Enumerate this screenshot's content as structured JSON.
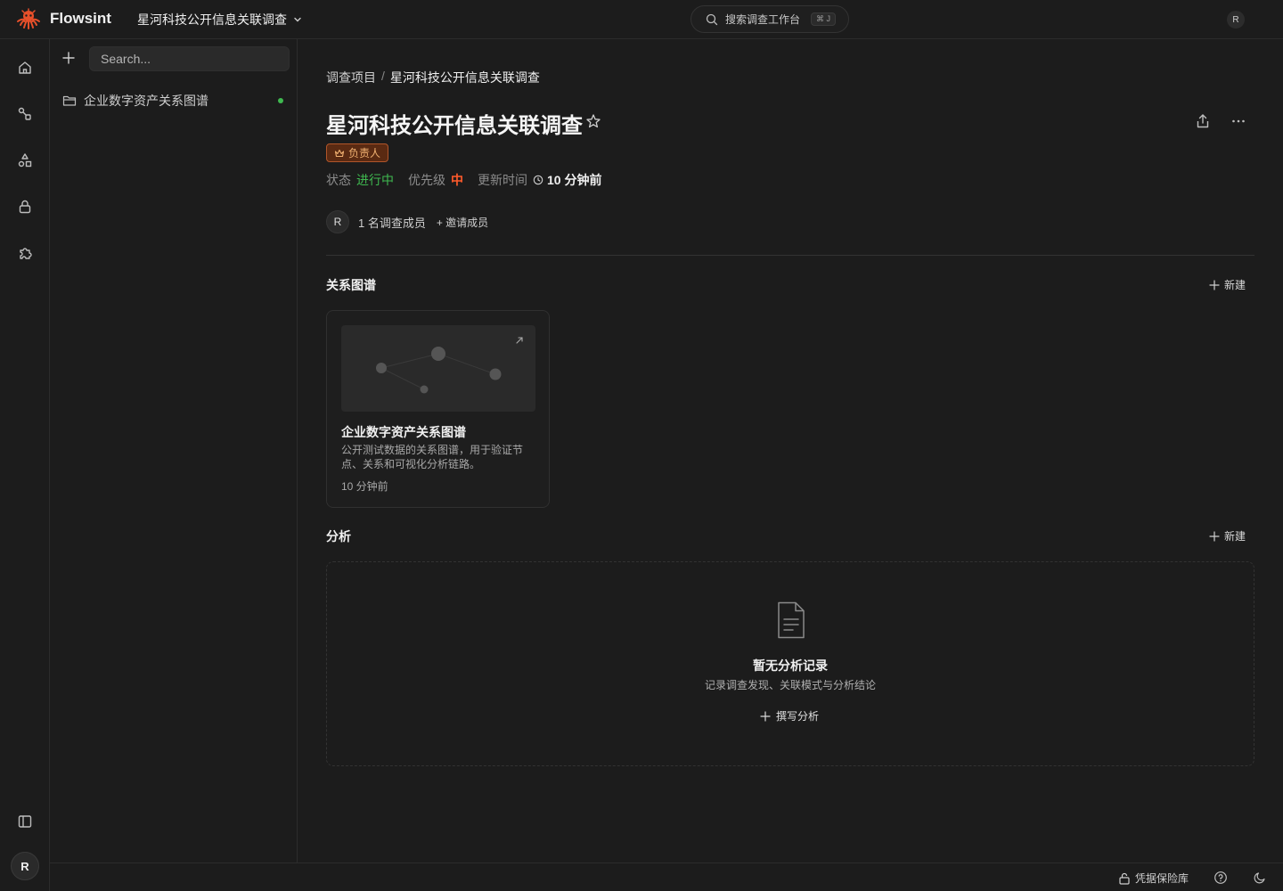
{
  "topbar": {
    "brand": "Flowsint",
    "project": "星河科技公开信息关联调查",
    "search_label": "搜索调查工作台",
    "search_kbd": "⌘ J",
    "user_initial": "R"
  },
  "sidebar": {
    "search_placeholder": "Search...",
    "items": [
      {
        "label": "企业数字资产关系图谱",
        "status_color": "#3fb950"
      }
    ]
  },
  "rail": {
    "icons": [
      "home-icon",
      "graph-icon",
      "shapes-icon",
      "lock-icon",
      "puzzle-icon"
    ],
    "user_initial": "R"
  },
  "main": {
    "breadcrumb": {
      "parent": "调查项目",
      "separator": "/",
      "current": "星河科技公开信息关联调查"
    },
    "title": "星河科技公开信息关联调查",
    "role_badge": "负责人",
    "meta": {
      "status_label": "状态",
      "status_value": "进行中",
      "priority_label": "优先级",
      "priority_value": "中",
      "updated_label": "更新时间",
      "updated_value": "10 分钟前"
    },
    "members": {
      "avatar": "R",
      "count_text": "1 名调查成员",
      "invite": "+ 邀请成员"
    },
    "graphs_section": {
      "title": "关系图谱",
      "new_label": "新建",
      "cards": [
        {
          "title": "企业数字资产关系图谱",
          "description": "公开测试数据的关系图谱，用于验证节点、关系和可视化分析链路。",
          "time": "10 分钟前"
        }
      ]
    },
    "analysis_section": {
      "title": "分析",
      "new_label": "新建",
      "empty_title": "暂无分析记录",
      "empty_sub": "记录调查发现、关联模式与分析结论",
      "write_label": "撰写分析"
    }
  },
  "statusbar": {
    "vault_label": "凭据保险库"
  },
  "colors": {
    "background": "#1c1c1c",
    "accent_green": "#3fb950",
    "priority_red": "#ff5a2b",
    "badge_orange": "#b0552a"
  }
}
